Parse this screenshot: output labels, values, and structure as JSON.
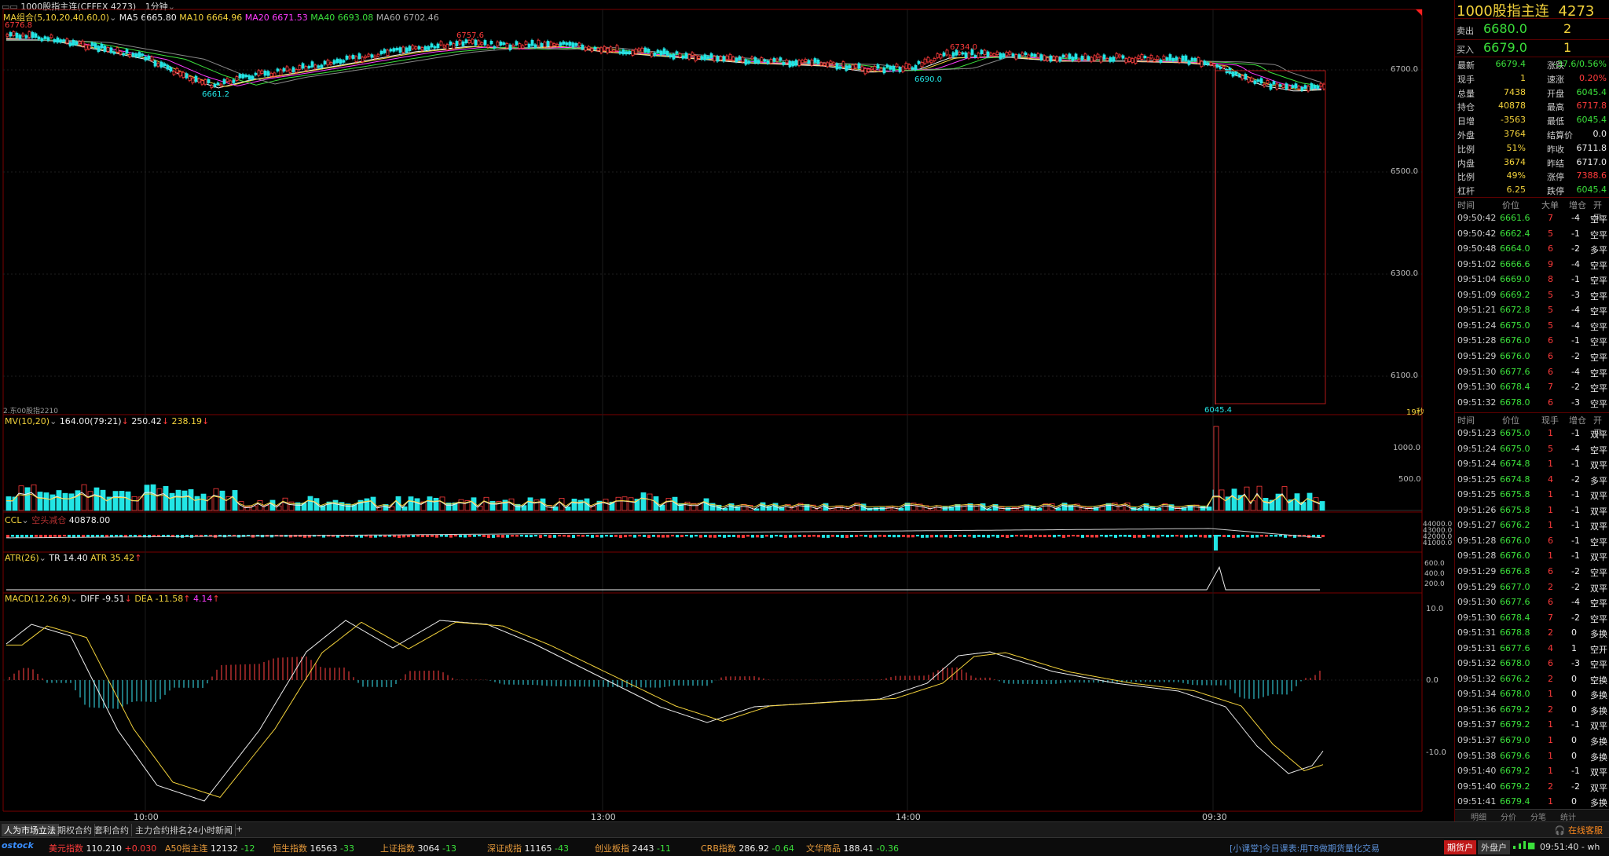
{
  "colors": {
    "up": "#ff3b3b",
    "down": "#22e5e5",
    "yellow": "#f3d23b",
    "green": "#3be03b",
    "axis": "#7a0000",
    "white": "#eeeeee",
    "magenta": "#ff3bff"
  },
  "title_bar": {
    "instrument": "1000股指主连(CFFEX 4273)",
    "period": "1分钟"
  },
  "ma_legend": {
    "name": "MA组合(5,10,20,40,60,0)",
    "ma5": "MA5 6665.80",
    "ma10": "MA10 6664.96",
    "ma20": "MA20 6671.53",
    "ma40": "MA40 6693.08",
    "ma60": "MA60 6702.46"
  },
  "price_annotations": {
    "high_left": "6776.8",
    "low1": "6661.2",
    "high_mid": "6757.6",
    "low2": "6690.0",
    "high_right": "6734.0",
    "spike_low": "6045.4",
    "bottom_left": "2.东00股指2210",
    "bottom_right": "19秒"
  },
  "price_axis": [
    "6700.0",
    "6500.0",
    "6300.0",
    "6100.0"
  ],
  "volume_legend": {
    "name": "MV(10,20)",
    "v1": "164.00(79:21)",
    "v2": "250.42",
    "v3": "238.19"
  },
  "volume_axis": [
    "1000.0",
    "500.0"
  ],
  "oi_legend": {
    "name": "CCL",
    "tag": "空头减仓",
    "value": "40878.00"
  },
  "oi_axis": [
    "44000.0",
    "43000.0",
    "42000.0",
    "41000.0"
  ],
  "atr_legend": {
    "name": "ATR(26)",
    "tr": "TR 14.40",
    "atr": "ATR 35.42"
  },
  "atr_axis": [
    "600.0",
    "400.0",
    "200.0"
  ],
  "macd_legend": {
    "name": "MACD(12,26,9)",
    "diff": "DIFF -9.51",
    "dea": "DEA -11.58",
    "macd": "4.14"
  },
  "macd_axis": [
    "10.0",
    "0.0",
    "-10.0"
  ],
  "time_axis": [
    "10:00",
    "13:00",
    "14:00",
    "09:30"
  ],
  "quote": {
    "title": "1000股指主连",
    "code": "4273",
    "ask_label": "卖出",
    "ask_price": "6680.0",
    "ask_vol": "2",
    "bid_label": "买入",
    "bid_price": "6679.0",
    "bid_vol": "1",
    "stats": [
      {
        "k1": "最新",
        "v1": "6679.4",
        "c1": "green",
        "k2": "涨跌",
        "v2": "-37.6/0.56%",
        "c2": "green"
      },
      {
        "k1": "现手",
        "v1": "1",
        "c1": "yellow",
        "k2": "速涨",
        "v2": "0.20%",
        "c2": "up"
      },
      {
        "k1": "总量",
        "v1": "7438",
        "c1": "yellow",
        "k2": "开盘",
        "v2": "6045.4",
        "c2": "green"
      },
      {
        "k1": "持仓",
        "v1": "40878",
        "c1": "yellow",
        "k2": "最高",
        "v2": "6717.8",
        "c2": "up"
      },
      {
        "k1": "日增",
        "v1": "-3563",
        "c1": "yellow",
        "k2": "最低",
        "v2": "6045.4",
        "c2": "green"
      },
      {
        "k1": "外盘",
        "v1": "3764",
        "c1": "yellow",
        "k2": "结算价",
        "v2": "0.0",
        "c2": "white"
      },
      {
        "k1": "比例",
        "v1": "51%",
        "c1": "yellow",
        "k2": "昨收",
        "v2": "6711.8",
        "c2": "white"
      },
      {
        "k1": "内盘",
        "v1": "3674",
        "c1": "yellow",
        "k2": "昨结",
        "v2": "6717.0",
        "c2": "white"
      },
      {
        "k1": "比例",
        "v1": "49%",
        "c1": "yellow",
        "k2": "涨停",
        "v2": "7388.6",
        "c2": "up"
      },
      {
        "k1": "杠杆",
        "v1": "6.25",
        "c1": "yellow",
        "k2": "跌停",
        "v2": "6045.4",
        "c2": "green"
      }
    ],
    "ticks1_header": [
      "时间",
      "价位",
      "大单",
      "增仓",
      "开平"
    ],
    "ticks1": [
      [
        "09:50:42",
        "6661.6",
        "7",
        "-4",
        "空平",
        "green"
      ],
      [
        "09:50:42",
        "6662.4",
        "5",
        "-1",
        "空平",
        "green"
      ],
      [
        "09:50:48",
        "6664.0",
        "6",
        "-2",
        "多平",
        "green"
      ],
      [
        "09:51:02",
        "6666.6",
        "9",
        "-4",
        "空平",
        "green"
      ],
      [
        "09:51:04",
        "6669.0",
        "8",
        "-1",
        "空平",
        "green"
      ],
      [
        "09:51:09",
        "6669.2",
        "5",
        "-3",
        "空平",
        "green"
      ],
      [
        "09:51:21",
        "6672.8",
        "5",
        "-4",
        "空平",
        "green"
      ],
      [
        "09:51:24",
        "6675.0",
        "5",
        "-4",
        "空平",
        "green"
      ],
      [
        "09:51:28",
        "6676.0",
        "6",
        "-1",
        "空平",
        "green"
      ],
      [
        "09:51:29",
        "6676.0",
        "6",
        "-2",
        "空平",
        "green"
      ],
      [
        "09:51:30",
        "6677.6",
        "6",
        "-4",
        "空平",
        "green"
      ],
      [
        "09:51:30",
        "6678.4",
        "7",
        "-2",
        "空平",
        "green"
      ],
      [
        "09:51:32",
        "6678.0",
        "6",
        "-3",
        "空平",
        "green"
      ]
    ],
    "ticks2_header": [
      "时间",
      "价位",
      "现手",
      "增仓",
      "开平"
    ],
    "ticks2": [
      [
        "09:51:23",
        "6675.0",
        "1",
        "-1",
        "双平",
        "green"
      ],
      [
        "09:51:24",
        "6675.0",
        "5",
        "-4",
        "空平",
        "green"
      ],
      [
        "09:51:24",
        "6674.8",
        "1",
        "-1",
        "双平",
        "green"
      ],
      [
        "09:51:25",
        "6674.8",
        "4",
        "-2",
        "多平",
        "green"
      ],
      [
        "09:51:25",
        "6675.8",
        "1",
        "-1",
        "双平",
        "green"
      ],
      [
        "09:51:26",
        "6675.8",
        "1",
        "-1",
        "双平",
        "green"
      ],
      [
        "09:51:27",
        "6676.2",
        "1",
        "-1",
        "双平",
        "green"
      ],
      [
        "09:51:28",
        "6676.0",
        "6",
        "-1",
        "空平",
        "green"
      ],
      [
        "09:51:28",
        "6676.0",
        "1",
        "-1",
        "双平",
        "green"
      ],
      [
        "09:51:29",
        "6676.8",
        "6",
        "-2",
        "空平",
        "green"
      ],
      [
        "09:51:29",
        "6677.0",
        "2",
        "-2",
        "双平",
        "green"
      ],
      [
        "09:51:30",
        "6677.6",
        "6",
        "-4",
        "空平",
        "green"
      ],
      [
        "09:51:30",
        "6678.4",
        "7",
        "-2",
        "空平",
        "green"
      ],
      [
        "09:51:31",
        "6678.8",
        "2",
        "0",
        "多换",
        "green"
      ],
      [
        "09:51:31",
        "6677.6",
        "4",
        "1",
        "空开",
        "green"
      ],
      [
        "09:51:32",
        "6678.0",
        "6",
        "-3",
        "空平",
        "green"
      ],
      [
        "09:51:32",
        "6676.2",
        "2",
        "0",
        "空换",
        "green"
      ],
      [
        "09:51:34",
        "6678.0",
        "1",
        "0",
        "多换",
        "green"
      ],
      [
        "09:51:36",
        "6679.2",
        "2",
        "0",
        "多换",
        "green"
      ],
      [
        "09:51:37",
        "6679.2",
        "1",
        "-1",
        "双平",
        "green"
      ],
      [
        "09:51:37",
        "6679.0",
        "1",
        "0",
        "多换",
        "green"
      ],
      [
        "09:51:38",
        "6679.6",
        "1",
        "0",
        "多换",
        "green"
      ],
      [
        "09:51:40",
        "6679.2",
        "1",
        "-1",
        "双平",
        "green"
      ],
      [
        "09:51:40",
        "6679.2",
        "2",
        "-2",
        "双平",
        "green"
      ],
      [
        "09:51:41",
        "6679.4",
        "1",
        "0",
        "多换",
        "green"
      ]
    ],
    "footer_tabs": [
      "明细",
      "分价",
      "分笔",
      "统计"
    ]
  },
  "bottom_tabs": [
    "人为市场立法",
    "期权合约",
    "套利合约",
    "主力合约排名",
    "24小时新闻",
    "+"
  ],
  "service": "在线客服",
  "status": {
    "logo": "ostock",
    "items": [
      {
        "name": "美元指数",
        "val": "110.210",
        "chg": "+0.030",
        "c": "up"
      },
      {
        "name": "A50指主连",
        "val": "12132",
        "chg": "-12",
        "c": "green"
      },
      {
        "name": "恒生指数",
        "val": "16563",
        "chg": "-33",
        "c": "green"
      },
      {
        "name": "上证指数",
        "val": "3064",
        "chg": "-13",
        "c": "green"
      },
      {
        "name": "深证成指",
        "val": "11165",
        "chg": "-43",
        "c": "green"
      },
      {
        "name": "创业板指",
        "val": "2443",
        "chg": "-11",
        "c": "green"
      },
      {
        "name": "CRB指数",
        "val": "286.92",
        "chg": "-0.64",
        "c": "green"
      },
      {
        "name": "文华商品",
        "val": "188.41",
        "chg": "-0.36",
        "c": "green"
      }
    ],
    "news": "[小课堂]今日课表:用T8做期货量化交易",
    "btn1": "期货户",
    "btn2": "外盘户",
    "clock": "09:51:40 - wh"
  }
}
